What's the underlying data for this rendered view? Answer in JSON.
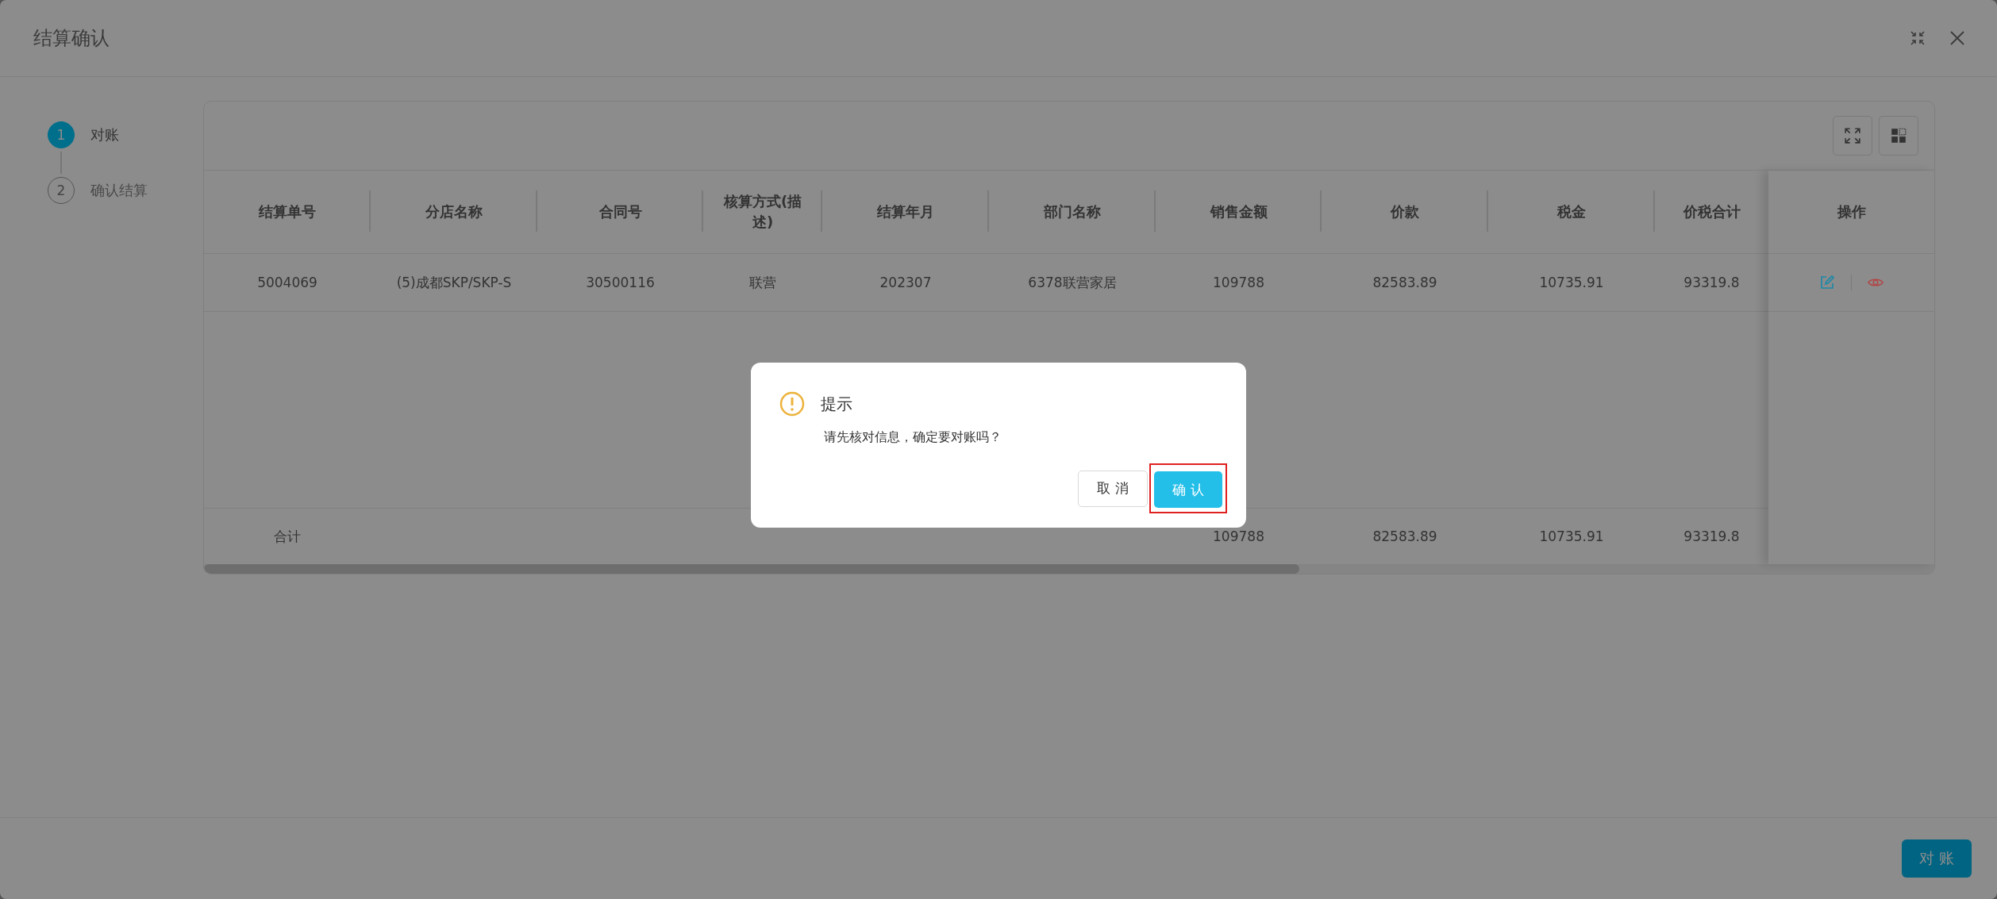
{
  "window": {
    "title": "结算确认"
  },
  "steps": [
    {
      "number": "1",
      "label": "对账",
      "selected": true
    },
    {
      "number": "2",
      "label": "确认结算",
      "selected": false
    }
  ],
  "table": {
    "columns": [
      "结算单号",
      "分店名称",
      "合同号",
      "核算方式(描述)",
      "结算年月",
      "部门名称",
      "销售金额",
      "价款",
      "税金",
      "价税合计"
    ],
    "action_column": "操作",
    "rows": [
      {
        "cells": [
          "5004069",
          "(5)成都SKP/SKP-S",
          "30500116",
          "联营",
          "202307",
          "6378联营家居",
          "109788",
          "82583.89",
          "10735.91",
          "93319.8"
        ]
      }
    ],
    "summary": {
      "label": "合计",
      "cells": [
        "",
        "",
        "",
        "",
        "",
        "",
        "109788",
        "82583.89",
        "10735.91",
        "93319.8"
      ]
    }
  },
  "dialog": {
    "title": "提示",
    "message": "请先核对信息，确定要对账吗？",
    "buttons": [
      {
        "label": "取 消",
        "kind": "secondary",
        "highlighted": false
      },
      {
        "label": "确 认",
        "kind": "primary",
        "highlighted": true
      }
    ]
  },
  "footer": {
    "button": "对 账"
  }
}
